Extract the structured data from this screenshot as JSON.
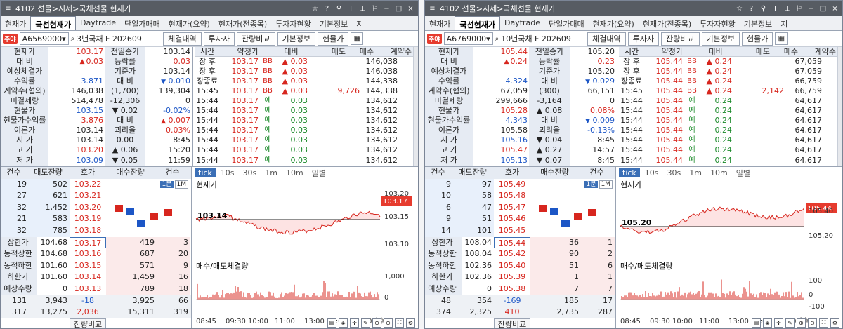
{
  "windows": [
    {
      "title": "4102 선물>시세>국채선물 현재가",
      "tabs": [
        "현재가",
        "국선현재가",
        "Daytrade",
        "단일가매매",
        "현재가(요약)",
        "현재가(전종목)",
        "투자자현황",
        "기본정보",
        "지"
      ],
      "active_tab": 1,
      "fav_label": "주야",
      "code": "A6569000",
      "name": "3년국채 F 202609",
      "buttons": [
        "체결내역",
        "투자자",
        "잔량비교",
        "기본정보",
        "현물가"
      ],
      "info_rows": [
        {
          "l": "현재가",
          "v": "103.17",
          "vc": "red",
          "arrow": "",
          "r": "전일종가",
          "rv": "103.14",
          "rc": ""
        },
        {
          "l": "대 비",
          "v": "0.03",
          "vc": "red",
          "arrow": "▲",
          "r": "등락률",
          "rv": "0.03",
          "rc": "red"
        },
        {
          "l": "예상체결가",
          "v": "",
          "vc": "",
          "arrow": "",
          "r": "기준가",
          "rv": "103.14",
          "rc": ""
        },
        {
          "l": "수익률",
          "v": "3.871",
          "vc": "blue",
          "arrow": "",
          "r": "대 비",
          "rv": "0.010",
          "rc": "blue",
          "rarrow": "▼"
        },
        {
          "l": "계약수(협의)",
          "v": "146,038",
          "vc": "",
          "arrow": "",
          "r": "(1,700)",
          "rv": "139,304",
          "rc": ""
        },
        {
          "l": "미결제량",
          "v": "514,478",
          "vc": "",
          "arrow": "",
          "r": "-12,306",
          "rv": "0",
          "rc": ""
        },
        {
          "l": "현물가",
          "v": "103.15",
          "vc": "blue",
          "arrow": "",
          "r": "▼ 0.02",
          "rv": "-0.02%",
          "rc": "blue"
        },
        {
          "l": "현물가수익률",
          "v": "3.876",
          "vc": "red",
          "arrow": "",
          "r": "대 비",
          "rv": "0.007",
          "rc": "red",
          "rarrow": "▲"
        },
        {
          "l": "이론가",
          "v": "103.14",
          "vc": "",
          "arrow": "",
          "r": "괴리율",
          "rv": "0.03%",
          "rc": "red"
        },
        {
          "l": "시 가",
          "v": "103.14",
          "vc": "",
          "arrow": "",
          "r": "0.00",
          "rv": "8:45",
          "rc": ""
        },
        {
          "l": "고 가",
          "v": "103.20",
          "vc": "red",
          "arrow": "",
          "r": "▲ 0.06",
          "rv": "15:20",
          "rc": ""
        },
        {
          "l": "저 가",
          "v": "103.09",
          "vc": "blue",
          "arrow": "",
          "r": "▼ 0.05",
          "rv": "11:59",
          "rc": ""
        }
      ],
      "trade_header": [
        "시간",
        "약정가",
        "대비",
        "매도",
        "매수",
        "계약수"
      ],
      "trades": [
        {
          "t": "장 후",
          "p": "103.17",
          "f": "BB",
          "d": "▲ 0.03",
          "s": "",
          "b": "",
          "q": "146,038",
          "fc": "red"
        },
        {
          "t": "장 후",
          "p": "103.17",
          "f": "BB",
          "d": "▲ 0.03",
          "s": "",
          "b": "",
          "q": "146,038",
          "fc": "red"
        },
        {
          "t": "장종료",
          "p": "103.17",
          "f": "BB",
          "d": "▲ 0.03",
          "s": "",
          "b": "",
          "q": "144,338",
          "fc": "red"
        },
        {
          "t": "15:45",
          "p": "103.17",
          "f": "BB",
          "d": "▲ 0.03",
          "s": "",
          "b": "9,726",
          "q": "144,338",
          "fc": "red"
        },
        {
          "t": "15:44",
          "p": "103.17",
          "f": "예",
          "d": "0.03",
          "s": "",
          "b": "",
          "q": "134,612",
          "fc": "grn"
        },
        {
          "t": "15:44",
          "p": "103.17",
          "f": "예",
          "d": "0.03",
          "s": "",
          "b": "",
          "q": "134,612",
          "fc": "grn"
        },
        {
          "t": "15:44",
          "p": "103.17",
          "f": "예",
          "d": "0.03",
          "s": "",
          "b": "",
          "q": "134,612",
          "fc": "grn"
        },
        {
          "t": "15:44",
          "p": "103.17",
          "f": "예",
          "d": "0.03",
          "s": "",
          "b": "",
          "q": "134,612",
          "fc": "grn"
        },
        {
          "t": "15:44",
          "p": "103.17",
          "f": "예",
          "d": "0.03",
          "s": "",
          "b": "",
          "q": "134,612",
          "fc": "grn"
        },
        {
          "t": "15:44",
          "p": "103.17",
          "f": "예",
          "d": "0.03",
          "s": "",
          "b": "",
          "q": "134,612",
          "fc": "grn"
        },
        {
          "t": "15:44",
          "p": "103.17",
          "f": "예",
          "d": "0.03",
          "s": "",
          "b": "",
          "q": "134,612",
          "fc": "grn"
        }
      ],
      "ob_header": [
        "건수",
        "매도잔량",
        "호가",
        "매수잔량",
        "건수"
      ],
      "asks": [
        {
          "c": "19",
          "q": "502",
          "p": "103.22"
        },
        {
          "c": "27",
          "q": "621",
          "p": "103.21"
        },
        {
          "c": "32",
          "q": "1,452",
          "p": "103.20"
        },
        {
          "c": "21",
          "q": "583",
          "p": "103.19"
        },
        {
          "c": "32",
          "q": "785",
          "p": "103.18"
        }
      ],
      "bids_info": [
        {
          "l": "상한가",
          "v": "104.68",
          "p": "103.17",
          "q": "419",
          "c": "3"
        },
        {
          "l": "동적상한",
          "v": "104.68",
          "p": "103.16",
          "q": "687",
          "c": "20"
        },
        {
          "l": "동적하한",
          "v": "101.60",
          "p": "103.15",
          "q": "571",
          "c": "9"
        },
        {
          "l": "하한가",
          "v": "101.60",
          "p": "103.14",
          "q": "1,459",
          "c": "16"
        },
        {
          "l": "예상수량",
          "v": "0",
          "p": "103.13",
          "q": "789",
          "c": "18"
        }
      ],
      "totals1": [
        "131",
        "3,943",
        "-18",
        "3,925",
        "66"
      ],
      "totals2": [
        "317",
        "13,275",
        "2,036",
        "15,311",
        "319"
      ],
      "compare": "잔량비교",
      "period_buttons": [
        "1분",
        "1M"
      ],
      "chart_tabs": [
        "tick",
        "10s",
        "30s",
        "1m",
        "10m",
        "일별"
      ],
      "chart_title": "현재가",
      "price_label": "103.17",
      "base_label": "103.14",
      "y_ticks": [
        "103.20",
        "103.15",
        "103.10"
      ],
      "vol_title": "매수/매도체결량",
      "vol_ticks": [
        "1,000",
        "0"
      ],
      "x_ticks": [
        "08:45",
        "09:30",
        "10:00",
        "11:00",
        "13:00",
        "14:00",
        "15:00",
        "장후"
      ]
    },
    {
      "title": "4102 선물>시세>국채선물 현재가",
      "tabs": [
        "현재가",
        "국선현재가",
        "Daytrade",
        "단일가매매",
        "현재가(요약)",
        "현재가(전종목)",
        "투자자현황",
        "기본정보",
        "지"
      ],
      "active_tab": 1,
      "fav_label": "주야",
      "code": "A6769000",
      "name": "10년국채 F 202609",
      "buttons": [
        "체결내역",
        "투자자",
        "잔량비교",
        "기본정보",
        "현물가"
      ],
      "info_rows": [
        {
          "l": "현재가",
          "v": "105.44",
          "vc": "red",
          "arrow": "",
          "r": "전일종가",
          "rv": "105.20",
          "rc": ""
        },
        {
          "l": "대 비",
          "v": "0.24",
          "vc": "red",
          "arrow": "▲",
          "r": "등락률",
          "rv": "0.23",
          "rc": "red"
        },
        {
          "l": "예상체결가",
          "v": "",
          "vc": "",
          "arrow": "",
          "r": "기준가",
          "rv": "105.20",
          "rc": ""
        },
        {
          "l": "수익률",
          "v": "4.324",
          "vc": "blue",
          "arrow": "",
          "r": "대 비",
          "rv": "0.029",
          "rc": "blue",
          "rarrow": "▼"
        },
        {
          "l": "계약수(협의)",
          "v": "67,059",
          "vc": "",
          "arrow": "",
          "r": "(300)",
          "rv": "66,151",
          "rc": ""
        },
        {
          "l": "미결제량",
          "v": "299,666",
          "vc": "",
          "arrow": "",
          "r": "-3,164",
          "rv": "0",
          "rc": ""
        },
        {
          "l": "현물가",
          "v": "105.28",
          "vc": "red",
          "arrow": "",
          "r": "▲ 0.08",
          "rv": "0.08%",
          "rc": "red"
        },
        {
          "l": "현물가수익률",
          "v": "4.343",
          "vc": "blue",
          "arrow": "",
          "r": "대 비",
          "rv": "0.009",
          "rc": "blue",
          "rarrow": "▼"
        },
        {
          "l": "이론가",
          "v": "105.58",
          "vc": "",
          "arrow": "",
          "r": "괴리율",
          "rv": "-0.13%",
          "rc": "blue"
        },
        {
          "l": "시 가",
          "v": "105.16",
          "vc": "blue",
          "arrow": "",
          "r": "▼ 0.04",
          "rv": "8:45",
          "rc": ""
        },
        {
          "l": "고 가",
          "v": "105.47",
          "vc": "red",
          "arrow": "",
          "r": "▲ 0.27",
          "rv": "14:57",
          "rc": ""
        },
        {
          "l": "저 가",
          "v": "105.13",
          "vc": "blue",
          "arrow": "",
          "r": "▼ 0.07",
          "rv": "8:45",
          "rc": ""
        }
      ],
      "trade_header": [
        "시간",
        "약정가",
        "대비",
        "매도",
        "매수",
        "계약수"
      ],
      "trades": [
        {
          "t": "장 후",
          "p": "105.44",
          "f": "BB",
          "d": "▲ 0.24",
          "s": "",
          "b": "",
          "q": "67,059",
          "fc": "red"
        },
        {
          "t": "장 후",
          "p": "105.44",
          "f": "BB",
          "d": "▲ 0.24",
          "s": "",
          "b": "",
          "q": "67,059",
          "fc": "red"
        },
        {
          "t": "장종료",
          "p": "105.44",
          "f": "BB",
          "d": "▲ 0.24",
          "s": "",
          "b": "",
          "q": "66,759",
          "fc": "red"
        },
        {
          "t": "15:45",
          "p": "105.44",
          "f": "BB",
          "d": "▲ 0.24",
          "s": "",
          "b": "2,142",
          "q": "66,759",
          "fc": "red"
        },
        {
          "t": "15:44",
          "p": "105.44",
          "f": "예",
          "d": "0.24",
          "s": "",
          "b": "",
          "q": "64,617",
          "fc": "grn"
        },
        {
          "t": "15:44",
          "p": "105.44",
          "f": "예",
          "d": "0.24",
          "s": "",
          "b": "",
          "q": "64,617",
          "fc": "grn"
        },
        {
          "t": "15:44",
          "p": "105.44",
          "f": "예",
          "d": "0.24",
          "s": "",
          "b": "",
          "q": "64,617",
          "fc": "grn"
        },
        {
          "t": "15:44",
          "p": "105.44",
          "f": "예",
          "d": "0.24",
          "s": "",
          "b": "",
          "q": "64,617",
          "fc": "grn"
        },
        {
          "t": "15:44",
          "p": "105.44",
          "f": "예",
          "d": "0.24",
          "s": "",
          "b": "",
          "q": "64,617",
          "fc": "grn"
        },
        {
          "t": "15:44",
          "p": "105.44",
          "f": "예",
          "d": "0.24",
          "s": "",
          "b": "",
          "q": "64,617",
          "fc": "grn"
        },
        {
          "t": "15:44",
          "p": "105.44",
          "f": "예",
          "d": "0.24",
          "s": "",
          "b": "",
          "q": "64,617",
          "fc": "grn"
        }
      ],
      "ob_header": [
        "건수",
        "매도잔량",
        "호가",
        "매수잔량",
        "건수"
      ],
      "asks": [
        {
          "c": "9",
          "q": "97",
          "p": "105.49"
        },
        {
          "c": "10",
          "q": "58",
          "p": "105.48"
        },
        {
          "c": "6",
          "q": "47",
          "p": "105.47"
        },
        {
          "c": "9",
          "q": "51",
          "p": "105.46"
        },
        {
          "c": "14",
          "q": "101",
          "p": "105.45"
        }
      ],
      "bids_info": [
        {
          "l": "상한가",
          "v": "108.04",
          "p": "105.44",
          "q": "36",
          "c": "1"
        },
        {
          "l": "동적상한",
          "v": "108.04",
          "p": "105.42",
          "q": "90",
          "c": "2"
        },
        {
          "l": "동적하한",
          "v": "102.36",
          "p": "105.40",
          "q": "51",
          "c": "6"
        },
        {
          "l": "하한가",
          "v": "102.36",
          "p": "105.39",
          "q": "1",
          "c": "1"
        },
        {
          "l": "예상수량",
          "v": "0",
          "p": "105.38",
          "q": "7",
          "c": "7"
        }
      ],
      "totals1": [
        "48",
        "354",
        "-169",
        "185",
        "17"
      ],
      "totals2": [
        "374",
        "2,325",
        "410",
        "2,735",
        "287"
      ],
      "compare": "잔량비교",
      "period_buttons": [
        "1분",
        "1M"
      ],
      "chart_tabs": [
        "tick",
        "10s",
        "30s",
        "1m",
        "10m",
        "일별"
      ],
      "chart_title": "현재가",
      "price_label": "105.44",
      "base_label": "105.20",
      "y_ticks": [
        "105.40",
        "105.20"
      ],
      "vol_title": "매수/매도체결량",
      "vol_ticks": [
        "100",
        "0",
        "-100"
      ],
      "x_ticks": [
        "08:45",
        "09:30",
        "10:00",
        "11:00",
        "13:00",
        "14:00",
        "15:00",
        "장후"
      ]
    }
  ]
}
